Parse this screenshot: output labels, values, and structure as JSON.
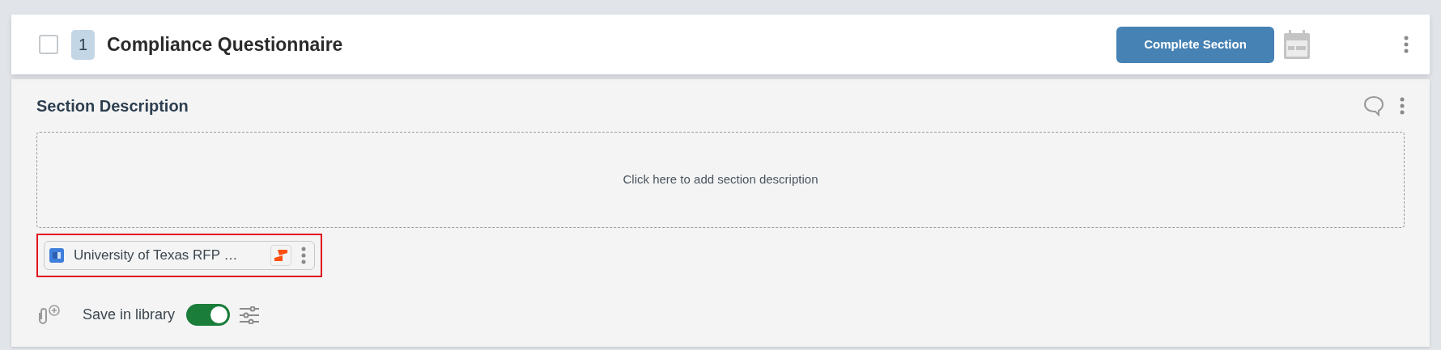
{
  "section": {
    "checked": false,
    "number": "1",
    "title": "Compliance Questionnaire",
    "complete_button": "Complete Section"
  },
  "description": {
    "heading": "Section Description",
    "placeholder": "Click here to add section description"
  },
  "attachment": {
    "name": "University of Texas RFP …",
    "highlighted": true
  },
  "footer": {
    "save_label": "Save in library",
    "save_on": true
  }
}
